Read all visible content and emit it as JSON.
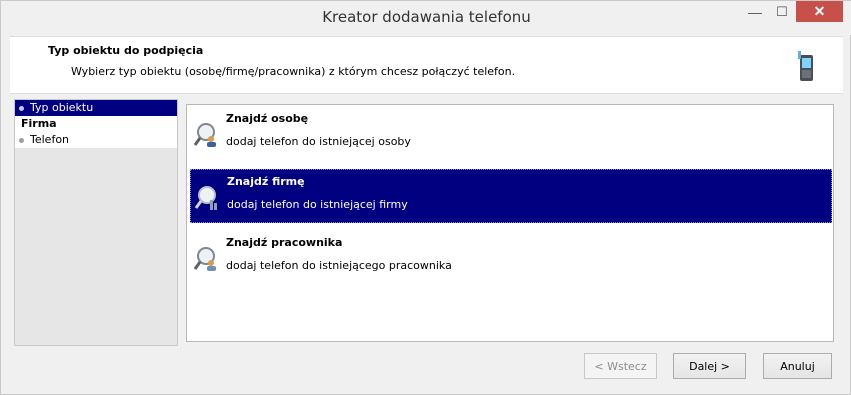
{
  "window": {
    "title": "Kreator dodawania telefonu",
    "min_glyph": "—",
    "max_glyph": "☐",
    "close_glyph": "✕"
  },
  "header": {
    "title": "Typ obiektu do podpięcia",
    "subtitle": "Wybierz typ obiektu (osobę/firmę/pracownika) z którym chcesz połączyć telefon."
  },
  "steps": [
    {
      "label": "Typ obiektu",
      "state": "active"
    },
    {
      "label": "Firma",
      "state": "bold"
    },
    {
      "label": "Telefon",
      "state": "normal"
    }
  ],
  "options": [
    {
      "title": "Znajdź osobę",
      "description": "dodaj telefon do istniejącej osoby",
      "icon": "find-person-icon",
      "selected": false
    },
    {
      "title": "Znajdź firmę",
      "description": "dodaj telefon do istniejącej firmy",
      "icon": "find-company-icon",
      "selected": true
    },
    {
      "title": "Znajdź pracownika",
      "description": "dodaj telefon do istniejącego pracownika",
      "icon": "find-employee-icon",
      "selected": false
    }
  ],
  "buttons": {
    "back": "< Wstecz",
    "next": "Dalej >",
    "cancel": "Anuluj"
  },
  "colors": {
    "selection": "#000080",
    "close": "#c7504b"
  }
}
